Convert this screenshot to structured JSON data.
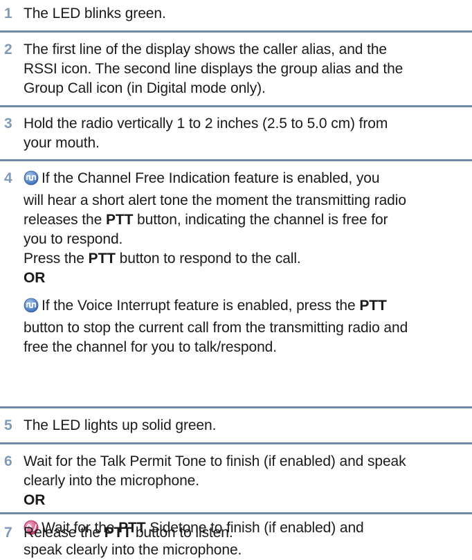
{
  "steps": {
    "s1": {
      "number": "1",
      "line1": "The LED blinks green."
    },
    "s2": {
      "number": "2",
      "line1": "The first line of the display shows the caller alias, and the",
      "line2": "RSSI icon. The second line displays the group alias and the",
      "line3": "Group Call icon (in Digital mode only)."
    },
    "s3": {
      "number": "3",
      "line1": "Hold the radio vertically 1 to 2 inches (2.5 to 5.0 cm) from",
      "line2": "your mouth."
    },
    "s4": {
      "number": "4",
      "a_line1": "If the Channel Free Indication feature is enabled, you",
      "a_line2": "will hear a short alert tone the moment the transmitting radio",
      "a_line3_pre": "releases the ",
      "a_line3_bold": "PTT",
      "a_line3_post": " button, indicating the channel is free for",
      "a_line4": "you to respond.",
      "a_line5_pre": "Press the ",
      "a_line5_bold": "PTT",
      "a_line5_post": " button to respond to the call.",
      "or": "OR",
      "b_line1_pre": "If the Voice Interrupt feature is enabled, press the ",
      "b_line1_bold": "PTT",
      "b_line2": "button to stop the current call from the transmitting radio and",
      "b_line3": "free the channel for you to talk/respond."
    },
    "s5": {
      "number": "5",
      "line1": "The LED lights up solid green."
    },
    "s6": {
      "number": "6",
      "line1": "Wait for the Talk Permit Tone to finish (if enabled) and speak",
      "line2": "clearly into the microphone.",
      "or": "OR",
      "b_line1_pre": "Wait for the ",
      "b_line1_bold": "PTT",
      "b_line1_post": " Sidetone to finish (if enabled) and",
      "b_line2": "speak clearly into the microphone."
    },
    "s7": {
      "number": "7",
      "line1_pre": "Release the ",
      "line1_bold": "PTT",
      "line1_post": " button to listen."
    }
  },
  "icons": {
    "digital_mode": "digital-mode-icon",
    "analog_mode": "analog-mode-icon"
  },
  "colors": {
    "step_number": "#7f9ab8",
    "rule": "#6f8aa6",
    "digital_icon": "#5a86c8",
    "analog_icon": "#d9447a"
  }
}
